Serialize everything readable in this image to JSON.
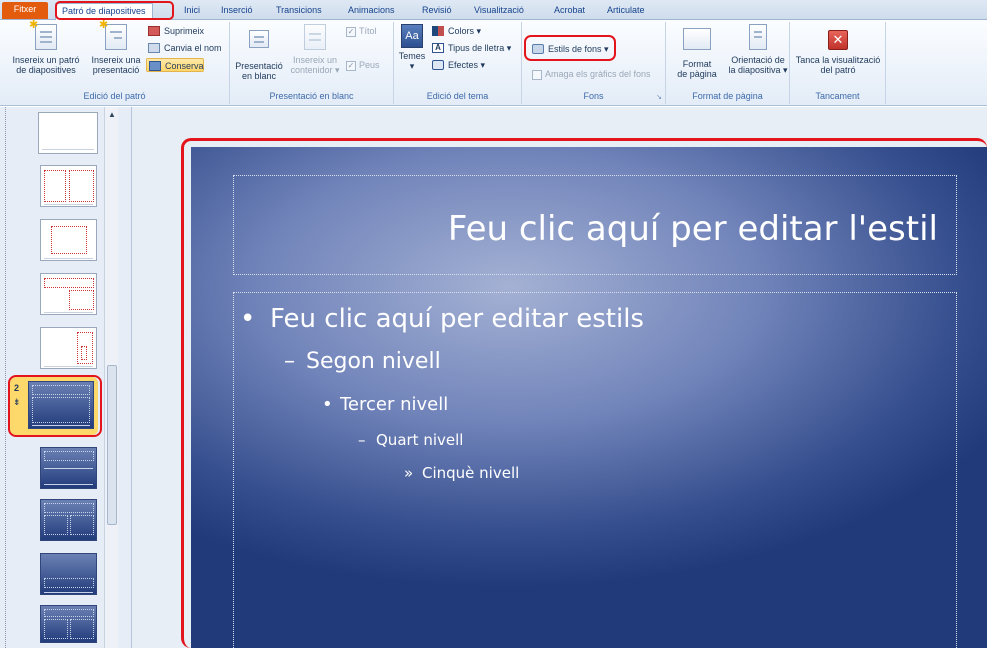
{
  "tabs": [
    "Fitxer",
    "Patró de diapositives",
    "Inici",
    "Inserció",
    "Transicions",
    "Animacions",
    "Revisió",
    "Visualització",
    "Acrobat",
    "Articulate"
  ],
  "ribbon": {
    "edicio_patro": {
      "label": "Edició del patró",
      "insert_master_1": "Insereix un patró",
      "insert_master_2": "de diapositives",
      "insert_layout_1": "Insereix una",
      "insert_layout_2": "presentació",
      "delete": "Suprimeix",
      "rename": "Canvia el nom",
      "preserve": "Conserva"
    },
    "presentacio_blanc": {
      "label": "Presentació en blanc",
      "layout_1": "Presentació",
      "layout_2": "en blanc",
      "insert_ph_1": "Insereix un",
      "insert_ph_2": "contenidor ▾",
      "title_chk": "Títol",
      "footers_chk": "Peus"
    },
    "edicio_tema": {
      "label": "Edició del tema",
      "themes": "Temes",
      "colors": "Colors ▾",
      "fonts": "Tipus de lletra ▾",
      "effects": "Efectes ▾"
    },
    "fons": {
      "label": "Fons",
      "bg_styles": "Estils de fons ▾",
      "hide_bg": "Amaga els gràfics del fons"
    },
    "format_pagina": {
      "label": "Format de pàgina",
      "page_setup_1": "Format",
      "page_setup_2": "de pàgina",
      "orientation_1": "Orientació de",
      "orientation_2": "la diapositiva ▾"
    },
    "tancament": {
      "label": "Tancament",
      "close_1": "Tanca la visualització",
      "close_2": "del patró"
    }
  },
  "thumbs": {
    "selected_number": "2",
    "selected_pin": "⇟"
  },
  "slide": {
    "title": "Feu clic aquí per editar l'estil",
    "level1": "Feu clic aquí per editar estils",
    "level2": "Segon nivell",
    "level3": "Tercer nivell",
    "level4": "Quart nivell",
    "level5": "Cinquè nivell",
    "bullet1": "•",
    "bullet2": "–",
    "bullet3": "•",
    "bullet4": "–",
    "bullet5": "»"
  },
  "colors": {
    "highlight_red": "#e3141b",
    "file_tab": "#e35c0e",
    "slide_dark": "#203a7a",
    "slide_light": "#a4b1d4"
  }
}
